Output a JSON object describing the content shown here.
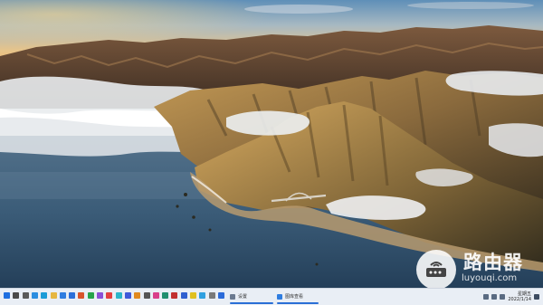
{
  "watermark": {
    "title": "路由器",
    "url": "luyouqi.com"
  },
  "taskbar": {
    "pinned_apps": [
      {
        "name": "start",
        "color": "#1f6fe0"
      },
      {
        "name": "search",
        "color": "#4a4a4a"
      },
      {
        "name": "task-view",
        "color": "#5a5a5a"
      },
      {
        "name": "widgets",
        "color": "#2b8de0"
      },
      {
        "name": "edge",
        "color": "#1a9bd7"
      },
      {
        "name": "file-explorer",
        "color": "#e6b640"
      },
      {
        "name": "store",
        "color": "#2f7de0"
      },
      {
        "name": "mail",
        "color": "#2b6fd9"
      },
      {
        "name": "app-9",
        "color": "#d9542b"
      },
      {
        "name": "app-10",
        "color": "#27a34a"
      },
      {
        "name": "app-11",
        "color": "#8a4fd6"
      },
      {
        "name": "app-12",
        "color": "#e23f3f"
      },
      {
        "name": "app-13",
        "color": "#2bb5c9"
      },
      {
        "name": "app-14",
        "color": "#3f5ad9"
      },
      {
        "name": "app-15",
        "color": "#e08a1f"
      },
      {
        "name": "app-16",
        "color": "#555555"
      },
      {
        "name": "app-17",
        "color": "#d93f8a"
      },
      {
        "name": "app-18",
        "color": "#1f8f6f"
      },
      {
        "name": "app-19",
        "color": "#c23030"
      },
      {
        "name": "app-20",
        "color": "#2f5fd0"
      },
      {
        "name": "app-21",
        "color": "#e0c020"
      },
      {
        "name": "app-22",
        "color": "#30a0e0"
      },
      {
        "name": "app-23",
        "color": "#7a7a7a"
      },
      {
        "name": "app-24",
        "color": "#2c6bd9"
      }
    ],
    "running_tasks": [
      {
        "label": "设置",
        "icon_color": "#6b7a90"
      },
      {
        "label": "图库查看",
        "icon_color": "#2f7de0"
      }
    ],
    "clock": {
      "time": "星期五",
      "date": "2022/1/14"
    }
  }
}
